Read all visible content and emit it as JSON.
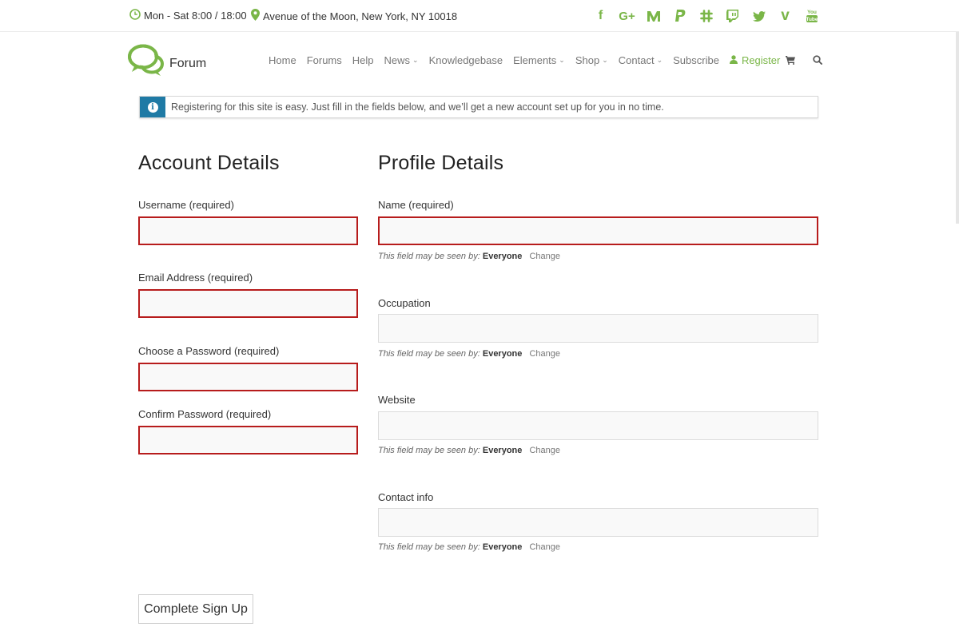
{
  "topbar": {
    "hours": "Mon - Sat 8:00 / 18:00",
    "address": "Avenue of the Moon, New York, NY 10018",
    "social": [
      {
        "icon": "facebook-icon",
        "glyph": "f"
      },
      {
        "icon": "google-plus-icon",
        "glyph": "G+"
      },
      {
        "icon": "medium-icon",
        "glyph": "M"
      },
      {
        "icon": "paypal-icon",
        "glyph": "P"
      },
      {
        "icon": "slack-icon",
        "glyph": "#"
      },
      {
        "icon": "twitch-icon",
        "glyph": "▢"
      },
      {
        "icon": "twitter-icon",
        "glyph": "🐦"
      },
      {
        "icon": "vimeo-icon",
        "glyph": "v"
      },
      {
        "icon": "youtube-icon",
        "glyph": "You"
      }
    ]
  },
  "brand": {
    "name": "Forum",
    "accent": "#7ab648"
  },
  "nav": {
    "home": "Home",
    "forums": "Forums",
    "help": "Help",
    "news": "News",
    "knowledgebase": "Knowledgebase",
    "elements": "Elements",
    "shop": "Shop",
    "contact": "Contact",
    "subscribe": "Subscribe",
    "register": "Register"
  },
  "notice": {
    "text": "Registering for this site is easy. Just fill in the fields below, and we’ll get a new account set up for you in no time.",
    "color": "#1f7aa5"
  },
  "account": {
    "heading": "Account Details",
    "username_label": "Username (required)",
    "email_label": "Email Address (required)",
    "password_label": "Choose a Password (required)",
    "confirm_label": "Confirm Password (required)"
  },
  "profile": {
    "heading": "Profile Details",
    "name_label": "Name (required)",
    "occupation_label": "Occupation",
    "website_label": "Website",
    "contact_label": "Contact info",
    "visibility_prefix": "This field may be seen by:",
    "visibility_value": "Everyone",
    "change_label": "Change"
  },
  "submit_label": "Complete Sign Up",
  "colors": {
    "error_border": "#b71c1c",
    "input_bg": "#f9f9f9"
  }
}
